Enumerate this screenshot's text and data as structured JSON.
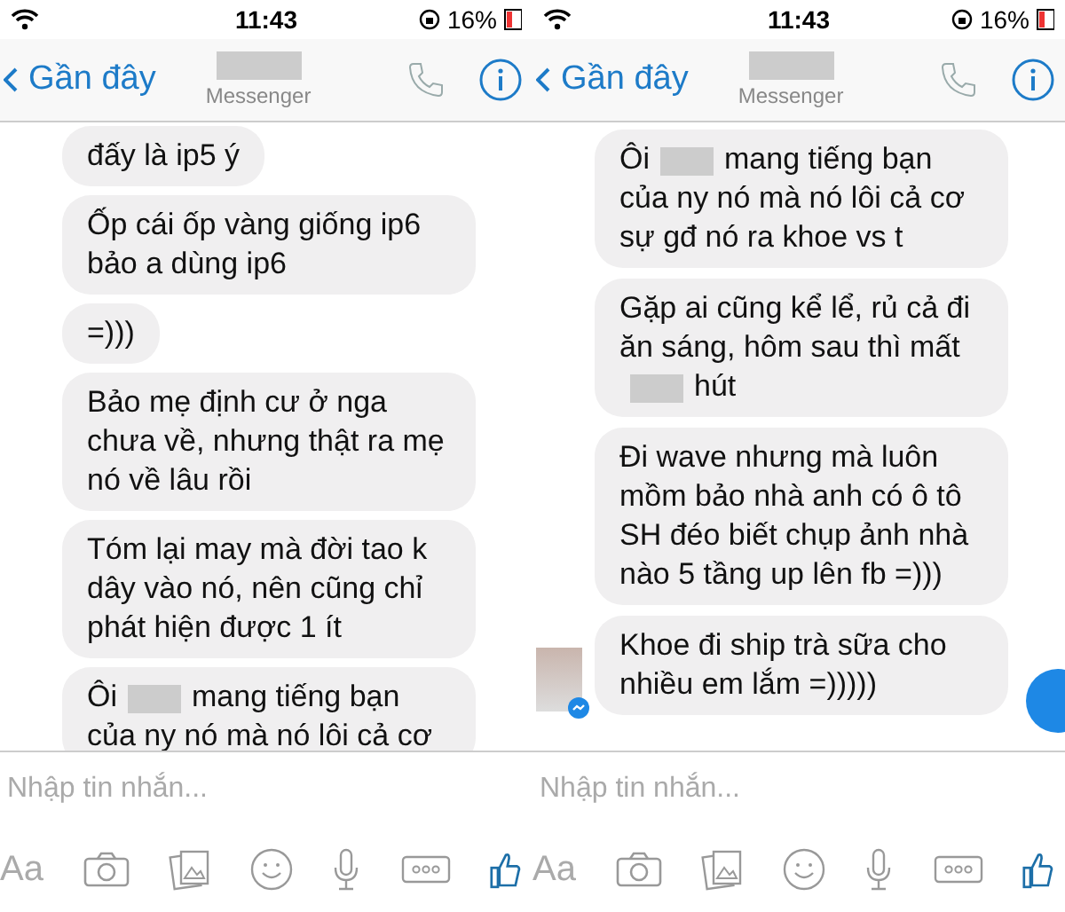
{
  "panels": [
    {
      "status": {
        "time": "11:43",
        "battery": "16%"
      },
      "nav": {
        "back": "Gần đây",
        "subtitle": "Messenger"
      },
      "chat_head": false,
      "messages": [
        {
          "parts": [
            {
              "kind": "text",
              "text": "đấy là ip5 ý"
            }
          ],
          "avatar": false
        },
        {
          "parts": [
            {
              "kind": "text",
              "text": "Ốp cái ốp vàng giống ip6 bảo a dùng ip6"
            }
          ],
          "avatar": false
        },
        {
          "parts": [
            {
              "kind": "text",
              "text": "=)))"
            }
          ],
          "avatar": false
        },
        {
          "parts": [
            {
              "kind": "text",
              "text": "Bảo mẹ định cư ở nga chưa về, nhưng thật ra mẹ nó về lâu rồi"
            }
          ],
          "avatar": false
        },
        {
          "parts": [
            {
              "kind": "text",
              "text": "Tóm lại may mà đời tao k dây vào nó, nên cũng chỉ phát hiện được 1 ít"
            }
          ],
          "avatar": false
        },
        {
          "parts": [
            {
              "kind": "text",
              "text": "Ôi"
            },
            {
              "kind": "redacted"
            },
            {
              "kind": "text",
              "text": "mang tiếng bạn của ny nó mà nó lôi cả cơ"
            }
          ],
          "avatar": false
        }
      ],
      "placeholder": "Nhập tin nhắn...",
      "toolbar": {
        "text_button": "Aa"
      }
    },
    {
      "status": {
        "time": "11:43",
        "battery": "16%"
      },
      "nav": {
        "back": "Gần đây",
        "subtitle": "Messenger"
      },
      "chat_head": true,
      "messages": [
        {
          "parts": [
            {
              "kind": "text",
              "text": "Ôi"
            },
            {
              "kind": "redacted"
            },
            {
              "kind": "text",
              "text": "mang tiếng bạn của ny nó mà nó lôi cả cơ sự gđ nó ra khoe vs t"
            }
          ],
          "avatar": false
        },
        {
          "parts": [
            {
              "kind": "text",
              "text": "Gặp ai cũng kể lể, rủ cả đi ăn sáng, hôm sau thì mất"
            },
            {
              "kind": "redacted"
            },
            {
              "kind": "text",
              "text": "hút"
            }
          ],
          "avatar": false
        },
        {
          "parts": [
            {
              "kind": "text",
              "text": "Đi wave nhưng mà luôn mồm bảo nhà anh có ô tô SH đéo biết chụp ảnh nhà nào 5 tầng up lên fb =)))"
            }
          ],
          "avatar": false
        },
        {
          "parts": [
            {
              "kind": "text",
              "text": "Khoe đi ship trà sữa cho nhiều em lắm =)))))"
            }
          ],
          "avatar": true
        }
      ],
      "placeholder": "Nhập tin nhắn...",
      "toolbar": {
        "text_button": "Aa"
      }
    }
  ]
}
